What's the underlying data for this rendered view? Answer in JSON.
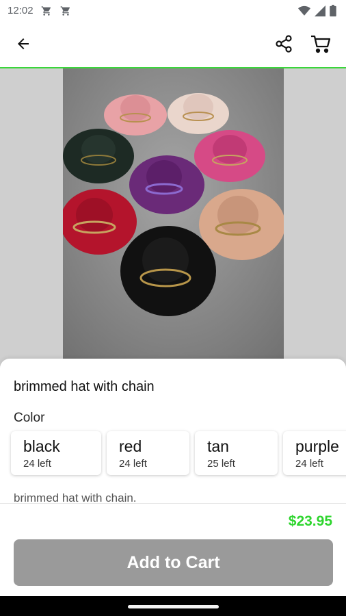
{
  "status_bar": {
    "time": "12:02",
    "notification_icons": [
      "cart-icon",
      "cart-icon"
    ],
    "right_icons": [
      "wifi-icon",
      "signal-icon",
      "battery-icon"
    ]
  },
  "app_bar": {
    "back_icon": "arrow-left-icon",
    "share_icon": "share-icon",
    "cart_icon": "cart-icon",
    "divider_color": "#3bd63b"
  },
  "product": {
    "title": "brimmed hat with chain",
    "color_label": "Color",
    "variants": [
      {
        "name": "black",
        "stock": "24 left"
      },
      {
        "name": "red",
        "stock": "24 left"
      },
      {
        "name": "tan",
        "stock": "25 left"
      },
      {
        "name": "purple",
        "stock": "24 left"
      }
    ],
    "description": "brimmed hat with chain."
  },
  "footer": {
    "price": "$23.95",
    "price_color": "#2ed52e",
    "add_to_cart_label": "Add to Cart",
    "button_color": "#9a9a9a"
  }
}
